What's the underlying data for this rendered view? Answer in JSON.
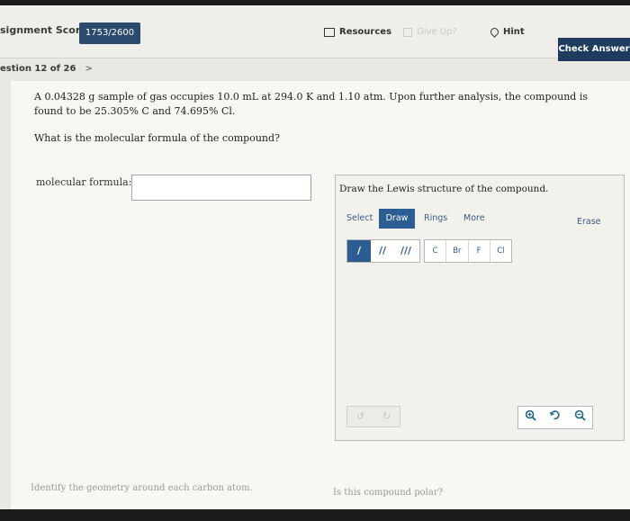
{
  "header": {
    "score_label": "signment Score:",
    "score_value": "1753/2600",
    "resources_label": "Resources",
    "giveup_label": "Give Up?",
    "hint_label": "Hint",
    "check_answer_label": "Check Answer"
  },
  "nav": {
    "question_label": "estion 12 of 26",
    "next_glyph": ">"
  },
  "problem": {
    "text": "A 0.04328 g sample of gas occupies 10.0 mL at 294.0 K and 1.10 atm. Upon further analysis, the compound is found to be 25.305% C and 74.695% Cl.",
    "question": "What is the molecular formula of the compound?"
  },
  "answer": {
    "label": "molecular formula:",
    "value": ""
  },
  "lewis": {
    "title": "Draw the Lewis structure of the compound.",
    "tabs": {
      "select": "Select",
      "draw": "Draw",
      "rings": "Rings",
      "more": "More",
      "erase": "Erase"
    },
    "bonds": {
      "single": "/",
      "double": "//",
      "triple": "///"
    },
    "atoms": [
      "C",
      "Br",
      "F",
      "Cl"
    ]
  },
  "footer": {
    "left_prompt": "Identify the geometry around each carbon atom.",
    "right_prompt": "Is this compound polar?"
  },
  "colors": {
    "score_badge": "#2c4a6e",
    "check_answer": "#1f3b5f",
    "draw_tab_active": "#2c5d92"
  }
}
